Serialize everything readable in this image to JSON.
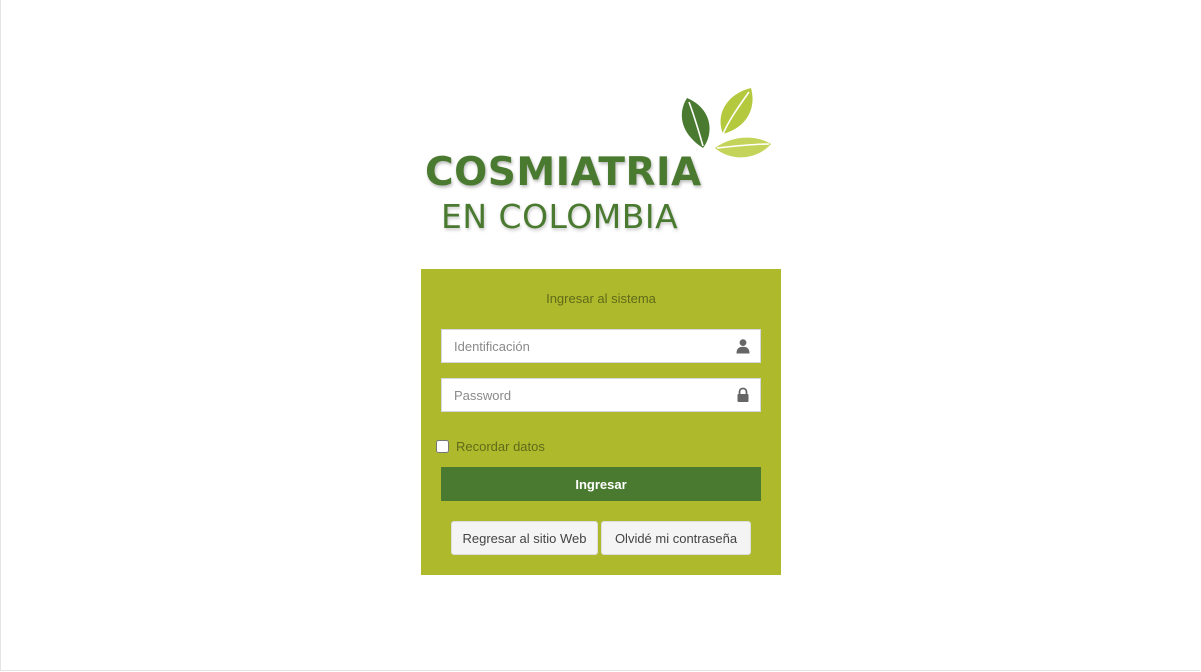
{
  "brand": {
    "line1": "COSMIATRIA",
    "line2": "EN COLOMBIA",
    "primary_color": "#4a7a2f",
    "panel_color": "#aeba2b",
    "leaf_light": "#b8cf4d",
    "leaf_dark": "#4a7a2f"
  },
  "login": {
    "title": "Ingresar al sistema",
    "username": {
      "placeholder": "Identificación",
      "value": "",
      "icon": "user-icon"
    },
    "password": {
      "placeholder": "Password",
      "value": "",
      "icon": "lock-icon"
    },
    "remember_label": "Recordar datos",
    "remember_checked": false,
    "submit_label": "Ingresar",
    "back_label": "Regresar al sitio Web",
    "forgot_label": "Olvidé mi contraseña"
  }
}
